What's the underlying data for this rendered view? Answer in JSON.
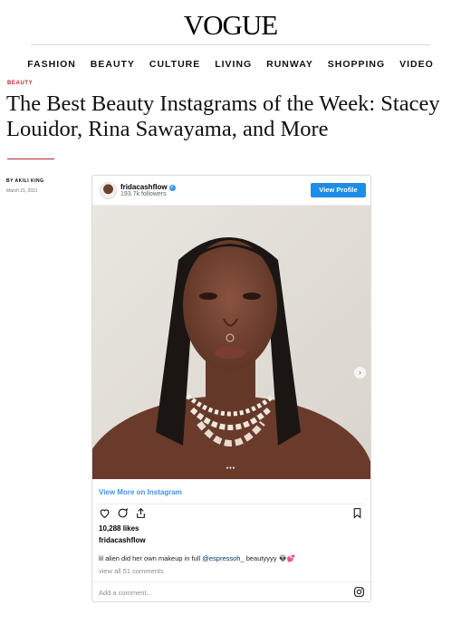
{
  "site": {
    "logo": "VOGUE"
  },
  "nav": [
    "FASHION",
    "BEAUTY",
    "CULTURE",
    "LIVING",
    "RUNWAY",
    "SHOPPING",
    "VIDEO"
  ],
  "article": {
    "category": "BEAUTY",
    "title": "The Best Beauty Instagrams of the Week: Stacey Louidor, Rina Sawayama, and More",
    "byline": "BY AKILI KING",
    "date": "March 21, 2021"
  },
  "post": {
    "username": "fridacashflow",
    "followers": "193.7k followers",
    "view_profile_label": "View Profile",
    "view_more_label": "View More on Instagram",
    "likes": "10,288 likes",
    "caption_user": "fridacashflow",
    "caption_text": "lil alien did her own makeup in full ",
    "caption_mention": "@espressoh_",
    "caption_end": " beautyyyy 👽💕",
    "view_all_comments": "view all 51 comments",
    "add_comment_placeholder": "Add a comment...",
    "carousel_dots": "•••"
  },
  "icons": {
    "heart": "heart-icon",
    "comment": "comment-icon",
    "share": "share-icon",
    "bookmark": "bookmark-icon",
    "instagram": "instagram-icon",
    "next": "chevron-right-icon"
  },
  "colors": {
    "accent": "#3897f0",
    "button": "#1e8de9",
    "category": "#b3282d"
  }
}
